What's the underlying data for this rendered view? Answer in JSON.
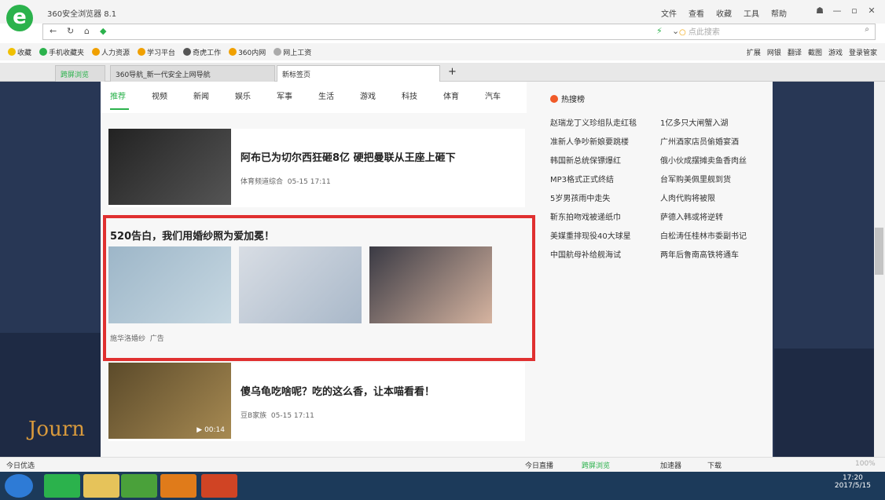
{
  "browser": {
    "title": "360安全浏览器 8.1",
    "menu": [
      "文件",
      "查看",
      "收藏",
      "工具",
      "帮助"
    ],
    "search_placeholder": "点此搜索",
    "zoom": "100%"
  },
  "bookmarks": [
    "收藏",
    "手机收藏夹",
    "人力资源",
    "学习平台",
    "奇虎工作",
    "360内网",
    "网上工资"
  ],
  "bookmarks_right": [
    "扩展",
    "网银",
    "翻译",
    "截图",
    "游戏",
    "登录管家"
  ],
  "tabs": [
    {
      "label": "跨屏浏览"
    },
    {
      "label": "360导航_新一代安全上网导航"
    },
    {
      "label": "新标签页"
    }
  ],
  "nav_tabs": [
    "推荐",
    "视频",
    "新闻",
    "娱乐",
    "军事",
    "生活",
    "游戏",
    "科技",
    "体育",
    "汽车"
  ],
  "news": [
    {
      "title": "阿布已为切尔西狂砸8亿 硬把曼联从王座上砸下",
      "source": "体育频道综合",
      "time": "05-15 17:11"
    },
    {
      "title": "傻乌龟吃啥呢？吃的这么香，让本喵看看！",
      "source": "豆B家族",
      "time": "05-15 17:11",
      "duration": "▶ 00:14"
    }
  ],
  "ad": {
    "title": "520告白，我们用婚纱照为爱加冕！",
    "source": "施华洛婚纱",
    "tag": "广告"
  },
  "hot": {
    "title": "热搜榜",
    "items": [
      [
        "赵瑞龙丁义珍组队走红毯",
        "1亿多只大闸蟹入湖"
      ],
      [
        "准新人争吵新娘要跳楼",
        "广州酒家店员偷婚宴酒"
      ],
      [
        "韩国新总统保镖爆红",
        "俄小伙成摆摊卖鱼香肉丝"
      ],
      [
        "MP3格式正式终结",
        "台军购美佩里舰到货"
      ],
      [
        "5岁男孩雨中走失",
        "人肉代购将被限"
      ],
      [
        "靳东拍吻戏被递纸巾",
        "萨德入韩或将逆转"
      ],
      [
        "美媒重排现役40大球星",
        "白松涛任桂林市委副书记"
      ],
      [
        "中国航母补给舰海试",
        "两年后鲁南高铁将通车"
      ]
    ]
  },
  "status": {
    "left": "今日优选",
    "items": [
      "今日直播",
      "跨屏浏览",
      "加速器",
      "下载"
    ]
  },
  "bg_text": "Journ",
  "clock": {
    "time": "17:20",
    "date": "2017/5/15"
  }
}
